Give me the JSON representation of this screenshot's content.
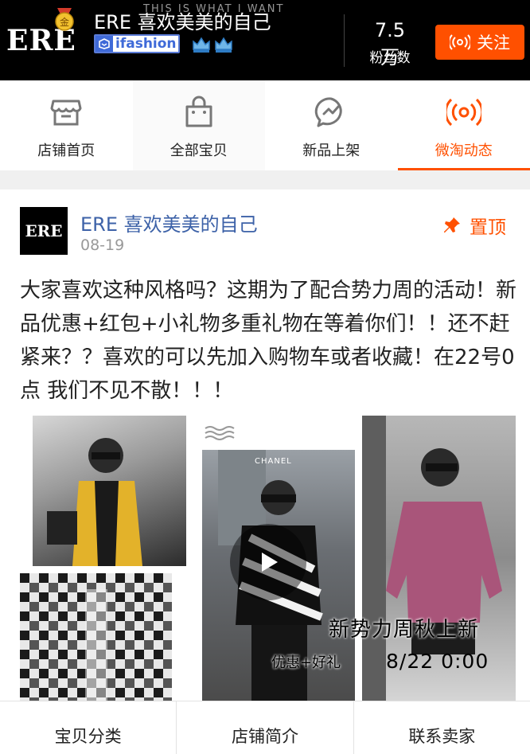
{
  "header": {
    "logo_text": "ERE",
    "medal_char": "金",
    "banner_text": "THIS IS WHAT I WANT",
    "shop_name": "ERE 喜欢美美的自己",
    "badge_label": "ifashion",
    "fans_count": "7.5万",
    "fans_label": "粉丝数",
    "follow_label": "关注"
  },
  "tabs": [
    {
      "label": "店铺首页",
      "icon": "storefront-icon"
    },
    {
      "label": "全部宝贝",
      "icon": "shopping-bag-icon"
    },
    {
      "label": "新品上架",
      "icon": "new-items-bubble-icon"
    },
    {
      "label": "微淘动态",
      "icon": "broadcast-icon",
      "active": true
    }
  ],
  "post": {
    "avatar_text": "ERE",
    "author": "ERE 喜欢美美的自己",
    "date": "08-19",
    "pin_label": "置顶",
    "text": "大家喜欢这种风格吗？这期为了配合势力周的活动！新品优惠+红包+小礼物多重礼物在等着你们！！还不赶紧来？？喜欢的可以先加入购物车或者收藏！在22号0点 我们不见不散！！！",
    "photo_overlay": {
      "title": "新势力周秋上新",
      "promo": "优惠+好礼",
      "date": "8/22 0:00",
      "brand_sign": "CHANEL"
    }
  },
  "bottom_nav": {
    "category": "宝贝分类",
    "intro": "店铺简介",
    "contact": "联系卖家"
  },
  "colors": {
    "accent": "#ff5000",
    "author_link": "#3d62a8",
    "header_bg": "#000000"
  }
}
